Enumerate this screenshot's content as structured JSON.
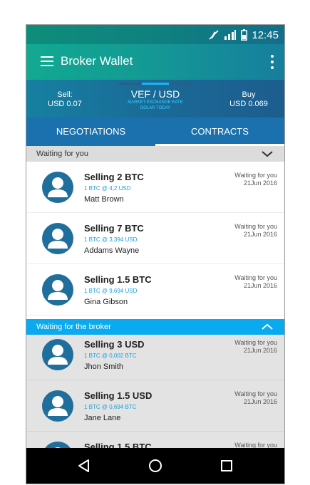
{
  "status_bar": {
    "time": "12:45"
  },
  "app_bar": {
    "title": "Broker Wallet"
  },
  "rates": {
    "sell_label": "Sell:",
    "sell_value": "USD 0.07",
    "pair": "VEF / USD",
    "subtitle_line1": "MARKET EXCHANGE RATE",
    "subtitle_line2": "DOLAR TODAY",
    "buy_label": "Buy",
    "buy_value": "USD 0.069"
  },
  "tabs": [
    {
      "label": "NEGOTIATIONS",
      "active": false
    },
    {
      "label": "CONTRACTS",
      "active": true
    }
  ],
  "sections": [
    {
      "header": "Waiting for you",
      "expanded": true,
      "items": [
        {
          "title": "Selling 2 BTC",
          "sub": "1 BTC @ 4,2 USD",
          "name": "Matt Brown",
          "status": "Waiting for you",
          "date": "21Jun 2016"
        },
        {
          "title": "Selling 7 BTC",
          "sub": "1 BTC @ 3,394 USD",
          "name": "Addams Wayne",
          "status": "Waiting for you",
          "date": "21Jun 2016"
        },
        {
          "title": "Selling 1.5 BTC",
          "sub": "1 BTC @ 9,694 USD",
          "name": "Gina Gibson",
          "status": "Waiting for you",
          "date": "21Jun 2016"
        }
      ]
    },
    {
      "header": "Waiting for the broker",
      "expanded": true,
      "items": [
        {
          "title": "Selling 3 USD",
          "sub": "1 BTC @ 0,002 BTC",
          "name": "Jhon Smith",
          "status": "Waiting for you",
          "date": "21Jun 2016"
        },
        {
          "title": "Selling 1.5 USD",
          "sub": "1 BTC @ 0,694 BTC",
          "name": "Jane Lane",
          "status": "Waiting for you",
          "date": "21Jun 2016"
        },
        {
          "title": "Selling 1.5 BTC",
          "sub": "",
          "name": "",
          "status": "Waiting for you",
          "date": ""
        }
      ]
    }
  ],
  "colors": {
    "accent": "#0aaaf0",
    "tab_bar": "#1a71ad",
    "avatar": "#1f6e9b"
  }
}
